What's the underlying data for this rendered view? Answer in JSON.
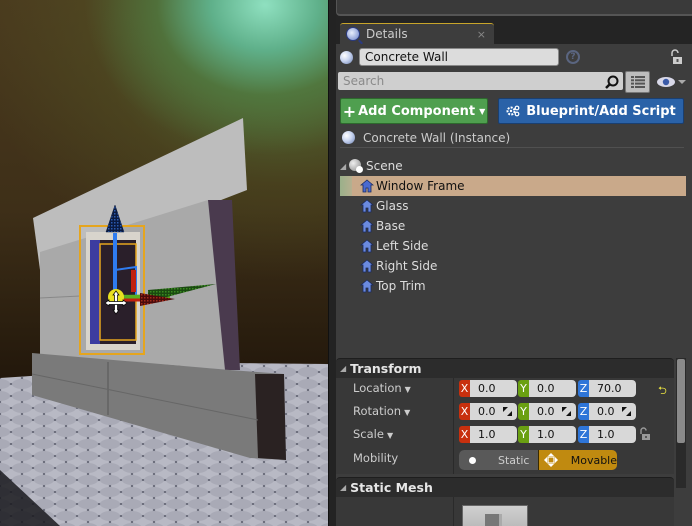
{
  "details_tab": {
    "label": "Details",
    "close": "×"
  },
  "actor": {
    "name": "Concrete Wall",
    "help": "?"
  },
  "search": {
    "placeholder": "Search",
    "value": ""
  },
  "buttons": {
    "add_component": "Add Component",
    "add_component_plus": "+",
    "add_component_caret": "▼",
    "blueprint": "Blueprint/Add Script"
  },
  "instance": {
    "label": "Concrete Wall (Instance)"
  },
  "component_tree": {
    "root": "Scene",
    "items": [
      {
        "label": "Window Frame",
        "selected": true
      },
      {
        "label": "Glass",
        "selected": false
      },
      {
        "label": "Base",
        "selected": false
      },
      {
        "label": "Left Side",
        "selected": false
      },
      {
        "label": "Right Side",
        "selected": false
      },
      {
        "label": "Top Trim",
        "selected": false
      }
    ]
  },
  "transform": {
    "title": "Transform",
    "location": {
      "label": "Location",
      "x": "0.0",
      "y": "0.0",
      "z": "70.0"
    },
    "rotation": {
      "label": "Rotation",
      "x": "0.0",
      "y": "0.0",
      "z": "0.0"
    },
    "scale": {
      "label": "Scale",
      "x": "1.0",
      "y": "1.0",
      "z": "1.0"
    },
    "mobility": {
      "label": "Mobility",
      "options": [
        "Static",
        "Movable"
      ],
      "selected": "Movable"
    },
    "axis_labels": {
      "x": "X",
      "y": "Y",
      "z": "Z"
    },
    "reset_glyph": "⮌"
  },
  "static_mesh": {
    "title": "Static Mesh"
  },
  "colors": {
    "add_component": "#4f9f4f",
    "blueprint": "#2a62a8",
    "selected_row": "#c9a98a",
    "movable": "#c08a10",
    "axis_x": "#c8300e",
    "axis_y": "#6aa012",
    "axis_z": "#2e75d8"
  }
}
